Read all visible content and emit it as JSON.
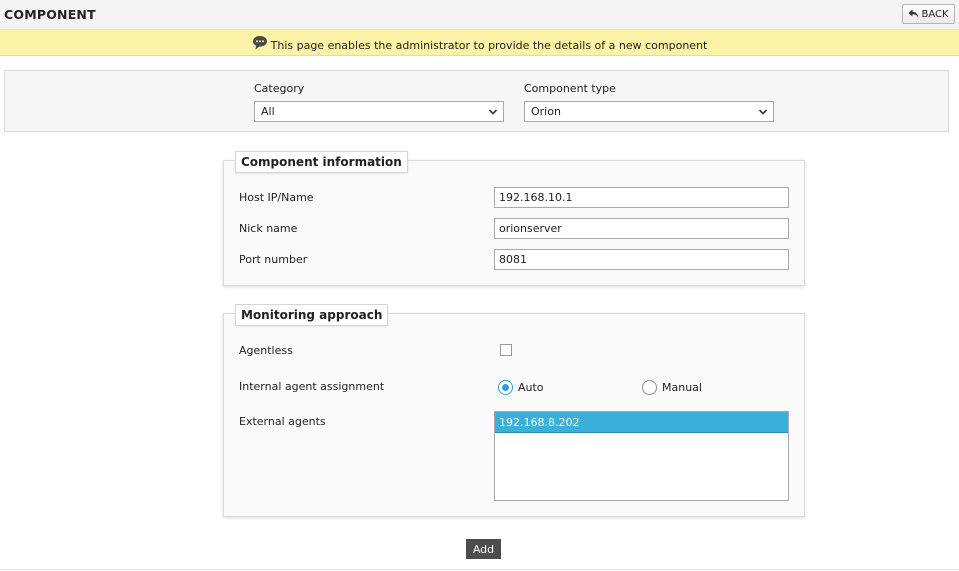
{
  "header": {
    "title": "COMPONENT",
    "back_label": "BACK"
  },
  "info": {
    "text": "This page enables the administrator to provide the details of a new component"
  },
  "filters": {
    "category_label": "Category",
    "category_value": "All",
    "component_type_label": "Component type",
    "component_type_value": "Orion"
  },
  "component_info": {
    "legend": "Component information",
    "host_label": "Host IP/Name",
    "host_value": "192.168.10.1",
    "nick_label": "Nick name",
    "nick_value": "orionserver",
    "port_label": "Port number",
    "port_value": "8081"
  },
  "monitoring": {
    "legend": "Monitoring approach",
    "agentless_label": "Agentless",
    "agentless_checked": false,
    "assignment_label": "Internal agent assignment",
    "auto_label": "Auto",
    "manual_label": "Manual",
    "selected_assignment": "Auto",
    "external_label": "External agents",
    "external_agents": [
      "192.168.8.202"
    ]
  },
  "actions": {
    "add_label": "Add"
  },
  "colors": {
    "accent": "#3aafd9",
    "info_bg": "#fdf3a8",
    "button_dark": "#4d4d4d"
  }
}
